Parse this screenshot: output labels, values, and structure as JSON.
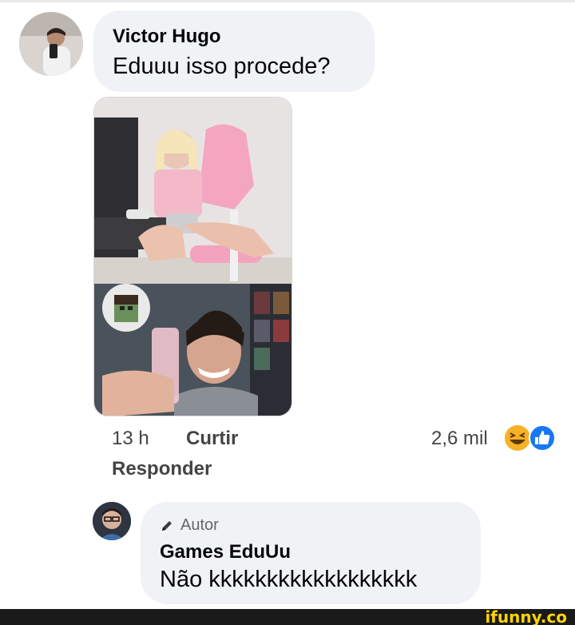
{
  "comment1": {
    "author": "Victor Hugo",
    "text": "Eduuu isso procede?",
    "time": "13 h",
    "like_label": "Curtir",
    "reply_label": "Responder",
    "reaction_count": "2,6 mil",
    "reactions": [
      "laugh-reaction-icon",
      "like-reaction-icon"
    ],
    "colors": {
      "bubble": "#f0f2f5",
      "like_blue": "#1877f2",
      "laugh_yellow": "#f7b125"
    }
  },
  "comment2": {
    "badge": "Autor",
    "author": "Games EduUu",
    "text": "Não kkkkkkkkkkkkkkkkkk"
  },
  "watermark": "ifunny.co"
}
